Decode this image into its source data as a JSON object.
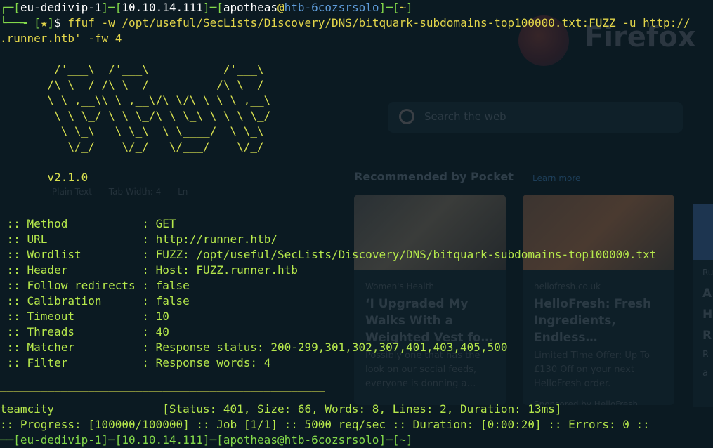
{
  "background_app": {
    "name": "Firefox",
    "search_placeholder": "Search the web",
    "pocket_heading": "Recommended by Pocket",
    "pocket_link": "Learn more",
    "cards": [
      {
        "source": "Women's Health",
        "title": "‘I Upgraded My Walks With a Weighted Vest fo…",
        "description": "Possibly one that has the look on our social feeds, everyone is donning a…"
      },
      {
        "source": "hellofresh.co.uk",
        "title": "HelloFresh: Fresh Ingredients, Endless…",
        "description": "Limited Time Offer: Up To £130 Off on your next HelloFresh order.",
        "sponsor": "Sponsored by HelloFresh"
      }
    ],
    "card3_letters": [
      "A",
      "H",
      "R"
    ],
    "card3_source": "Ru",
    "card3_desc_letters": [
      "R",
      "a"
    ],
    "editor_status": [
      "Plain Text",
      "Tab Width: 4",
      "Ln"
    ]
  },
  "prompt": {
    "top_corner": "┌─",
    "bottom_corner": "└──╼ ",
    "vpn": "eu-dedivip-1",
    "ip": "10.10.14.111",
    "user": "apotheas",
    "at": "@",
    "host": "htb-6cozsrsolo",
    "cwd": "~",
    "star": "★",
    "symbol": "$ "
  },
  "command_line1": "ffuf -w /opt/useful/SecLists/Discovery/DNS/bitquark-subdomains-top100000.txt:FUZZ -u http://",
  "command_line2": ".runner.htb' -fw 4",
  "banner": [
    "        /'___\\  /'___\\           /'___\\       ",
    "       /\\ \\__/ /\\ \\__/  __  __  /\\ \\__/       ",
    "       \\ \\ ,__\\\\ \\ ,__\\/\\ \\/\\ \\ \\ \\ ,__\\      ",
    "        \\ \\ \\_/ \\ \\ \\_/\\ \\ \\_\\ \\ \\ \\ \\_/      ",
    "         \\ \\_\\   \\ \\_\\  \\ \\____/  \\ \\_\\       ",
    "          \\/_/    \\/_/   \\/___/    \\/_/       "
  ],
  "version": "       v2.1.0",
  "separator": "________________________________________________",
  "config": [
    {
      "key": " :: Method           ",
      "value": ": GET"
    },
    {
      "key": " :: URL              ",
      "value": ": http://runner.htb/"
    },
    {
      "key": " :: Wordlist         ",
      "value": ": FUZZ: /opt/useful/SecLists/Discovery/DNS/bitquark-subdomains-top100000.txt"
    },
    {
      "key": " :: Header           ",
      "value": ": Host: FUZZ.runner.htb"
    },
    {
      "key": " :: Follow redirects ",
      "value": ": false"
    },
    {
      "key": " :: Calibration      ",
      "value": ": false"
    },
    {
      "key": " :: Timeout          ",
      "value": ": 10"
    },
    {
      "key": " :: Threads          ",
      "value": ": 40"
    },
    {
      "key": " :: Matcher          ",
      "value": ": Response status: 200-299,301,302,307,401,403,405,500"
    },
    {
      "key": " :: Filter           ",
      "value": ": Response words: 4"
    }
  ],
  "result": "teamcity                [Status: 401, Size: 66, Words: 8, Lines: 2, Duration: 13ms]",
  "progress": ":: Progress: [100000/100000] :: Job [1/1] :: 5000 req/sec :: Duration: [0:00:20] :: Errors: 0 ::",
  "next_prompt_partial": "──[eu-dedivip-1]─[10.10.14.111]─[apotheas@htb-6cozsrsolo]─[~]"
}
